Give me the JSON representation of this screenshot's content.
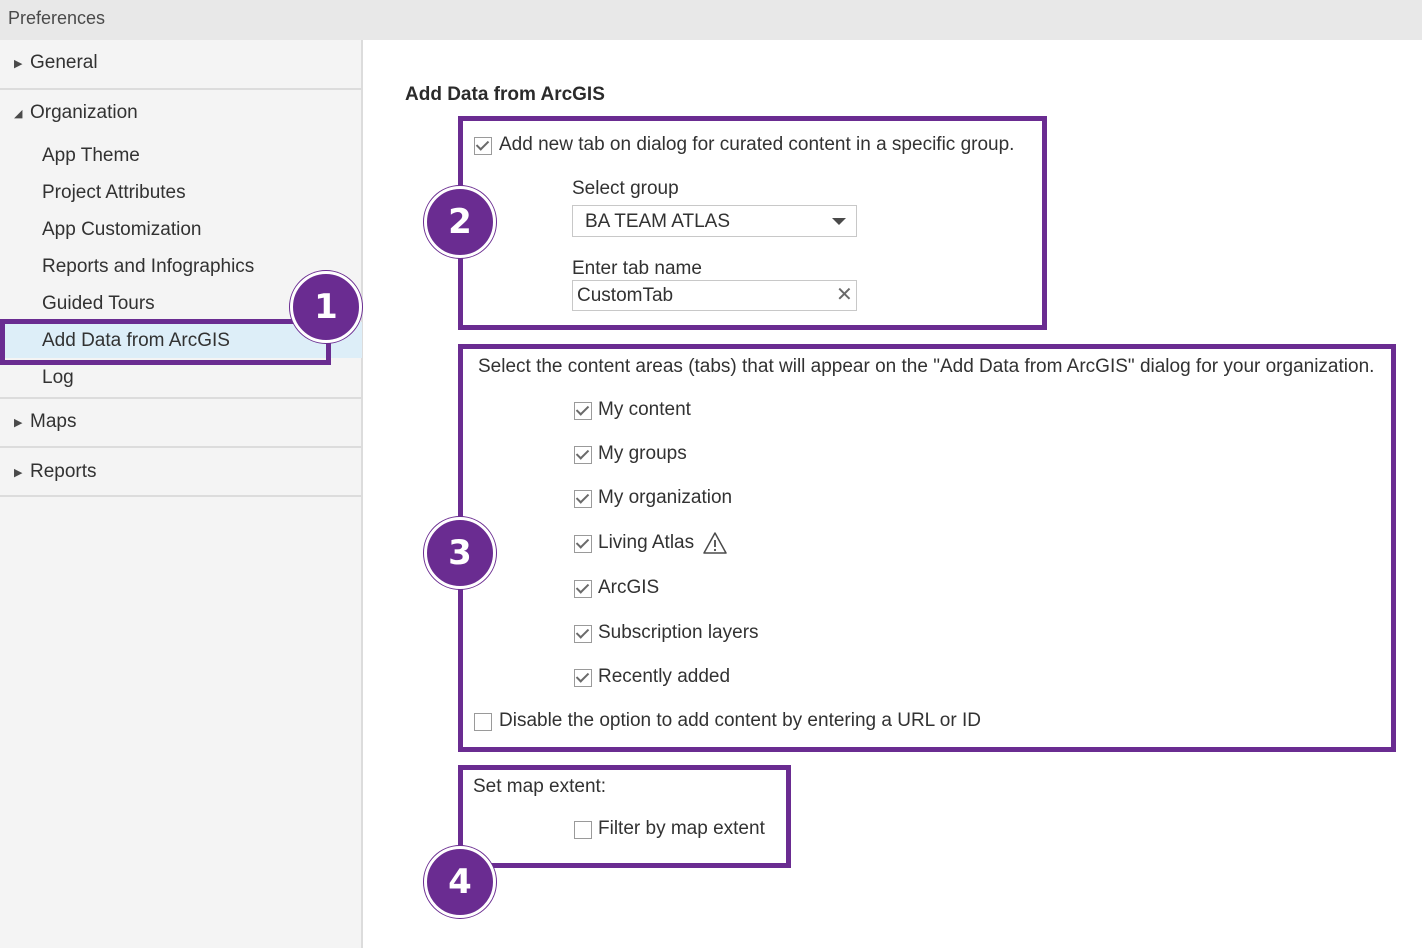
{
  "window": {
    "title": "Preferences"
  },
  "sidebar": {
    "general": "General",
    "organization": "Organization",
    "org_items": [
      "App Theme",
      "Project Attributes",
      "App Customization",
      "Reports and Infographics",
      "Guided Tours",
      "Add Data from ArcGIS",
      "Log"
    ],
    "maps": "Maps",
    "reports": "Reports",
    "active_item": "Add Data from ArcGIS"
  },
  "main": {
    "title": "Add Data from ArcGIS",
    "curated": {
      "checkbox_label": "Add new tab on dialog for curated content in a specific group.",
      "checked": true,
      "select_group_label": "Select group",
      "select_group_value": "BA TEAM ATLAS",
      "tab_name_label": "Enter tab name",
      "tab_name_value": "CustomTab"
    },
    "content_areas": {
      "intro": "Select the content areas (tabs) that will appear on the \"Add Data from ArcGIS\" dialog for your organization.",
      "items": [
        "My content",
        "My groups",
        "My organization",
        "Living Atlas",
        "ArcGIS",
        "Subscription layers",
        "Recently added"
      ],
      "disable_url_label": "Disable the option to add content by entering a URL or ID"
    },
    "map_extent": {
      "label": "Set map extent:",
      "filter_label": "Filter by map extent"
    }
  },
  "callouts": [
    "1",
    "2",
    "3",
    "4"
  ],
  "colors": {
    "callout": "#6a2c91",
    "active_bg": "#ddeef8"
  }
}
